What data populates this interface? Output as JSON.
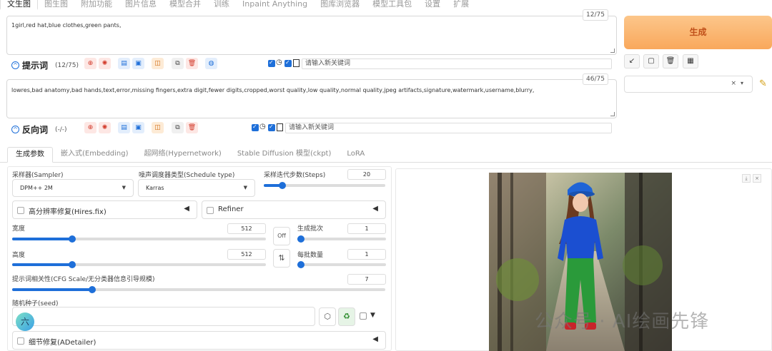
{
  "top_tabs": [
    "文生图",
    "图生图",
    "附加功能",
    "图片信息",
    "模型合并",
    "训练",
    "Inpaint Anything",
    "图库浏览器",
    "模型工具包",
    "设置",
    "扩展"
  ],
  "prompt": {
    "text": "1girl,red hat,blue clothes,green pants,",
    "token_count": "12/75",
    "label": "提示词",
    "count": "(12/75)",
    "keyword_placeholder": "请输入新关键词"
  },
  "negative": {
    "text": "lowres,bad anatomy,bad hands,text,error,missing fingers,extra digit,fewer digits,cropped,worst quality,low quality,normal quality,jpeg artifacts,signature,watermark,username,blurry,",
    "token_count": "46/75",
    "label": "反向词",
    "count": "(-/-)",
    "keyword_placeholder": "请输入新关键词"
  },
  "generate_label": "生成",
  "style_clear": "×",
  "style_arrow": "▾",
  "section_tabs": [
    "生成参数",
    "嵌入式(Embedding)",
    "超网络(Hypernetwork)",
    "Stable Diffusion 模型(ckpt)",
    "LoRA"
  ],
  "params": {
    "sampler_label": "采样器(Sampler)",
    "sampler_value": "DPM++ 2M",
    "schedule_label": "噪声调度器类型(Schedule type)",
    "schedule_value": "Karras",
    "steps_label": "采样迭代步数(Steps)",
    "steps_value": "20",
    "hires_label": "高分辨率修复(Hires.fix)",
    "refiner_label": "Refiner",
    "width_label": "宽度",
    "width_value": "512",
    "height_label": "高度",
    "height_value": "512",
    "batch_count_label": "生成批次",
    "batch_count_value": "1",
    "batch_size_label": "每批数量",
    "batch_size_value": "1",
    "off_label": "Off",
    "swap_label": "⇅",
    "cfg_label": "提示词相关性(CFG Scale/无分类器信息引导规模)",
    "cfg_value": "7",
    "seed_label": "随机种子(seed)",
    "seed_badge": "六",
    "adetailer_label": "细节修复(ADetailer)"
  },
  "watermark": "公众号 · AI绘画先锋",
  "accent": "#1e6fd9"
}
